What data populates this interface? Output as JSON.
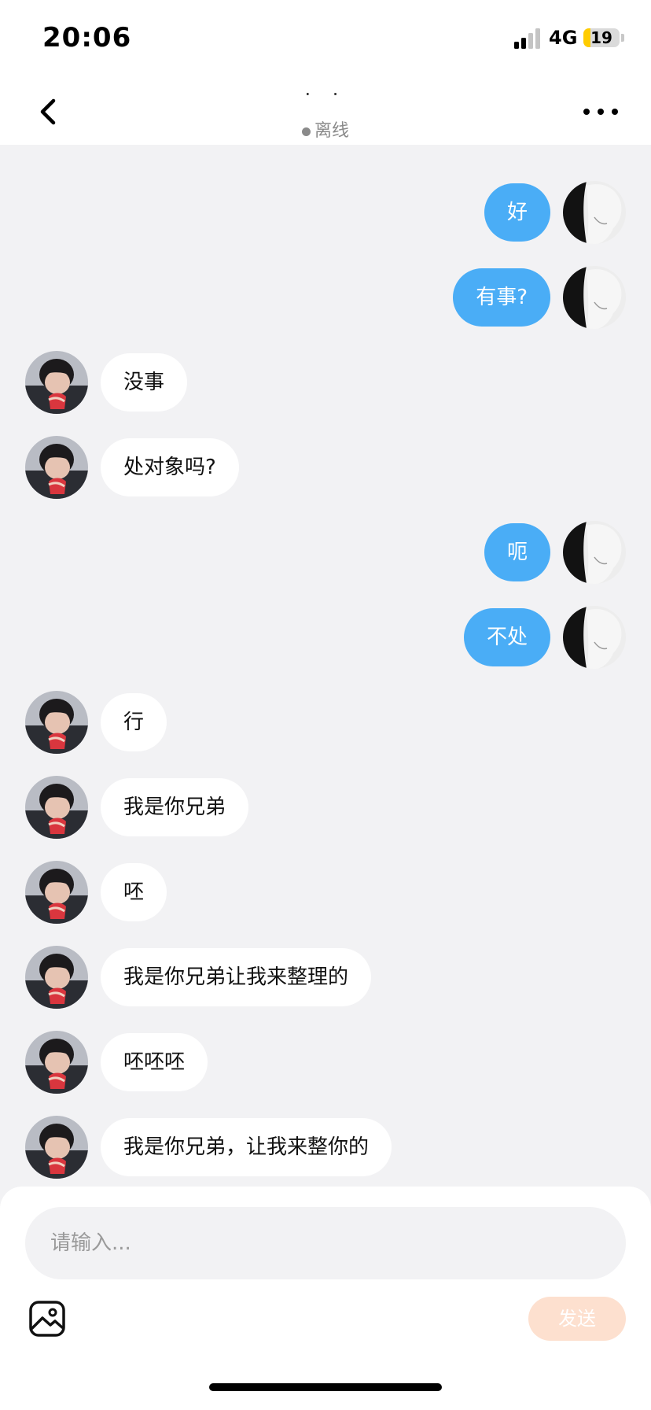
{
  "status_bar": {
    "time": "20:06",
    "network": "4G",
    "battery": "19",
    "battery_level": 0.19
  },
  "nav": {
    "title": "· ·",
    "status": "离线"
  },
  "messages": [
    {
      "side": "right",
      "text": "好"
    },
    {
      "side": "right",
      "text": "有事?"
    },
    {
      "side": "left",
      "text": "没事"
    },
    {
      "side": "left",
      "text": "处对象吗?"
    },
    {
      "side": "right",
      "text": "呃"
    },
    {
      "side": "right",
      "text": "不处"
    },
    {
      "side": "left",
      "text": "行"
    },
    {
      "side": "left",
      "text": "我是你兄弟"
    },
    {
      "side": "left",
      "text": "呸"
    },
    {
      "side": "left",
      "text": "我是你兄弟让我来整理的"
    },
    {
      "side": "left",
      "text": "呸呸呸"
    },
    {
      "side": "left",
      "text": "我是你兄弟，让我来整你的"
    }
  ],
  "composer": {
    "placeholder": "请输入...",
    "send_label": "发送"
  },
  "colors": {
    "accent_bubble": "#4aadf6",
    "send_disabled": "#fde0cf",
    "background": "#f2f2f4"
  }
}
